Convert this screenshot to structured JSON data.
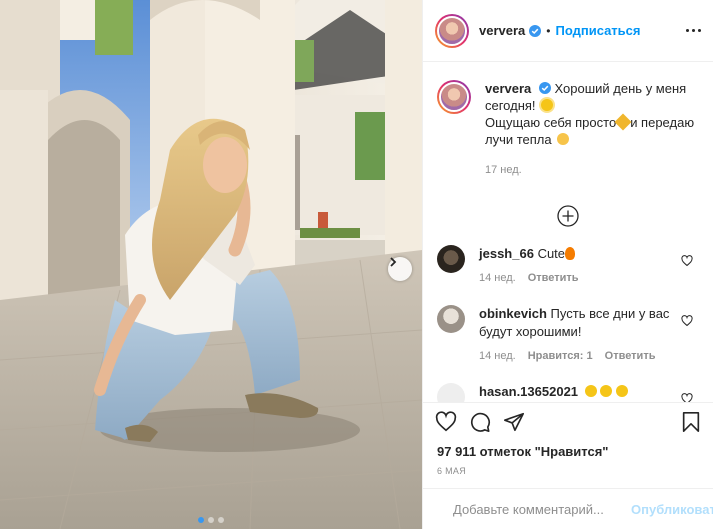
{
  "post": {
    "username": "ververa",
    "follow_label": "Подписаться",
    "bullet": "•",
    "caption": {
      "line1": "Хороший день у меня сегодня!",
      "line2": "Ощущаю себя просто",
      "line2b": "и передаю лучи тепла",
      "time": "17 нед."
    },
    "comments": [
      {
        "username": "jessh_66",
        "text": "Cute",
        "time": "14 нед.",
        "reply": "Ответить",
        "likes_label": ""
      },
      {
        "username": "obinkevich",
        "text": "Пусть все дни у вас будут хорошими!",
        "time": "14 нед.",
        "likes_label": "Нравится: 1",
        "reply": "Ответить"
      },
      {
        "username": "hasan.13652021",
        "text": ""
      }
    ],
    "likes": "97 911 отметок \"Нравится\"",
    "date": "6 МАЯ",
    "comment_placeholder": "Добавьте комментарий...",
    "publish_label": "Опубликовать",
    "carousel": {
      "count": 3,
      "active": 1
    },
    "colors": {
      "accent": "#0095f6",
      "publish_disabled": "#b2dffc",
      "muted": "#8e8e8e"
    },
    "icons": [
      "verified-badge-icon",
      "more-icon",
      "add-comment-circle-icon",
      "heart-icon",
      "comment-icon",
      "share-icon",
      "bookmark-icon",
      "emoji-icon",
      "chevron-right-icon"
    ]
  }
}
